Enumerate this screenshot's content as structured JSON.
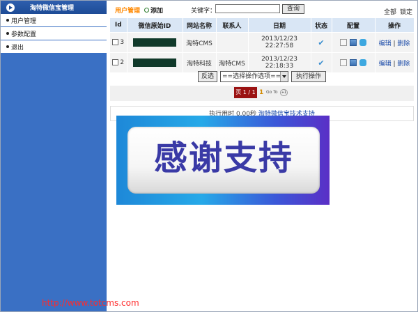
{
  "sidebar": {
    "title": "淘特微信宝管理",
    "items": [
      {
        "label": "用户管理"
      },
      {
        "label": "参数配置"
      },
      {
        "label": "退出"
      }
    ]
  },
  "topbar": {
    "title": "用户管理",
    "add_label": "添加",
    "keyword_label": "关键字：",
    "search_placeholder": "",
    "search_button": "查询",
    "all_label": "全部",
    "lock_label": "锁定"
  },
  "table": {
    "headers": [
      "Id",
      "微信原始ID",
      "网站名称",
      "联系人",
      "日期",
      "状态",
      "配置",
      "操作"
    ],
    "rows": [
      {
        "id": "3",
        "site": "淘特CMS",
        "contact": "",
        "date": "2013/12/23 22:27:58",
        "edit": "编辑",
        "delete": "删除"
      },
      {
        "id": "2",
        "site": "淘特科技",
        "contact": "淘特CMS",
        "date": "2013/12/23 22:18:33",
        "edit": "编辑",
        "delete": "删除"
      }
    ]
  },
  "actions": {
    "invert_label": "反选",
    "select_value": "==选择操作选项==",
    "execute_label": "执行操作"
  },
  "pager": {
    "page_label": "页 1 / 1",
    "current": "1",
    "goto_label": "Go To",
    "goto_btn": "+1"
  },
  "footer": {
    "exec_text": "执行用时 0.00秒",
    "support_link": "淘特微信宝技术支持"
  },
  "banner": {
    "text": "感谢支持"
  },
  "watermark": {
    "url": "http://www.totcms.com"
  },
  "colors": {
    "sidebar_bg": "#3a70c4",
    "accent_orange": "#ff8800",
    "pager_red": "#9b1212"
  }
}
